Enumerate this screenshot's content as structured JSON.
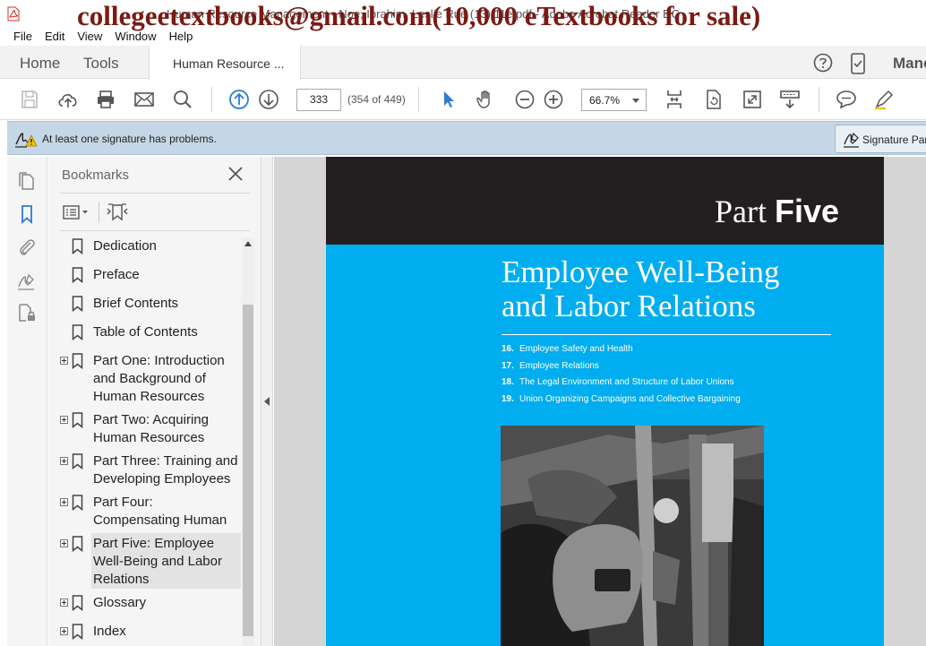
{
  "window": {
    "title": "Human Resource Management - Noe, Ibrahim, Leslie Rue (13) 11e.pdf - Adobe Acrobat Reader DC",
    "watermark": "collegeetextbooks@gmail.com(10,000 eTextbooks for sale)"
  },
  "menu": {
    "items": [
      "File",
      "Edit",
      "View",
      "Window",
      "Help"
    ]
  },
  "tabs": {
    "home": "Home",
    "tools": "Tools",
    "document": "Human Resource ...",
    "manage": "Manc"
  },
  "toolbar": {
    "page_number": "333",
    "page_count": "(354 of 449)",
    "zoom": "66.7%"
  },
  "message_bar": {
    "text": "At least one signature has problems.",
    "signature_panel_label": "Signature Panel"
  },
  "bookmarks": {
    "header": "Bookmarks",
    "items": [
      {
        "label": "Dedication",
        "expandable": false
      },
      {
        "label": "Preface",
        "expandable": false
      },
      {
        "label": "Brief Contents",
        "expandable": false
      },
      {
        "label": "Table of Contents",
        "expandable": false
      },
      {
        "label": "Part One: Introduction and Background of Human Resources",
        "expandable": true
      },
      {
        "label": "Part Two: Acquiring Human Resources",
        "expandable": true
      },
      {
        "label": "Part Three: Training and Developing Employees",
        "expandable": true
      },
      {
        "label": "Part Four: Compensating Human Resources",
        "expandable": true
      },
      {
        "label": "Part Five: Employee Well-Being and Labor Relations",
        "expandable": true,
        "selected": true
      },
      {
        "label": "Glossary",
        "expandable": true
      },
      {
        "label": "Index",
        "expandable": true
      }
    ]
  },
  "document_page": {
    "part_prefix": "Part",
    "part_number": "Five",
    "title_line1": "Employee Well-Being",
    "title_line2": "and Labor Relations",
    "chapters": [
      {
        "num": "16.",
        "title": "Employee Safety and Health"
      },
      {
        "num": "17.",
        "title": "Employee Relations"
      },
      {
        "num": "18.",
        "title": "The Legal Environment and Structure of Labor Unions"
      },
      {
        "num": "19.",
        "title": "Union Organizing Campaigns and Collective Bargaining"
      }
    ]
  },
  "colors": {
    "page_cyan": "#00adef",
    "page_dark_band": "#231f20",
    "accent_blue": "#2d7bd3",
    "watermark": "#7a1a12",
    "message_bar": "#c5d7e6"
  }
}
